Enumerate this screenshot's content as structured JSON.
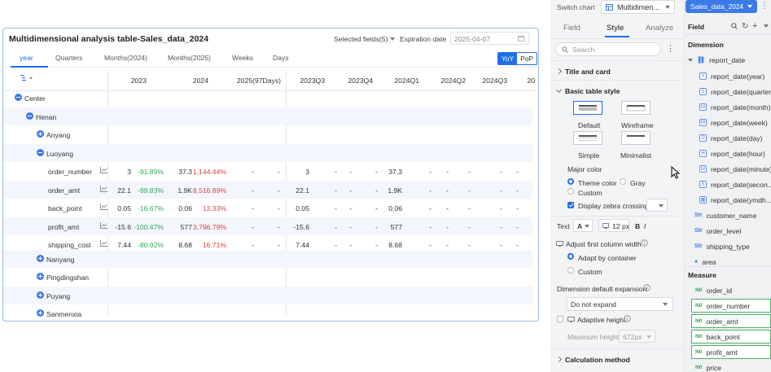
{
  "card": {
    "title": "Multidimensional analysis table-Sales_data_2024",
    "selected_fields": "Selected fields(5)",
    "expiration_label": "Expiration date",
    "expiration_value": "2025-04-07"
  },
  "tabs": [
    "year",
    "Quarters",
    "Months(2024)",
    "Months(2025)",
    "Weeks",
    "Days"
  ],
  "toggle": {
    "yoy": "YoY",
    "pop": "PoP"
  },
  "columns": [
    "2023",
    "2024",
    "2025(97Days)",
    "2023Q3",
    "2023Q4",
    "2024Q1",
    "2024Q2",
    "2024Q3",
    "20"
  ],
  "rows": [
    {
      "label": "Center"
    },
    {
      "label": "Henan"
    },
    {
      "label": "Anyang"
    },
    {
      "label": "Luoyang"
    },
    {
      "label": "order_number",
      "v2023": "3",
      "p2023": "-91.89%",
      "v2024": "37.3",
      "p2024": "1,144.44%",
      "q3": "3",
      "q1": "37.3"
    },
    {
      "label": "order_amt",
      "v2023": "22.1",
      "p2023": "-99.83%",
      "v2024": "1.9K",
      "p2024": "8,516.89%",
      "q3": "22.1",
      "q1": "1.9K"
    },
    {
      "label": "back_point",
      "v2023": "0.05",
      "p2023": "-16.67%",
      "v2024": "0.06",
      "p2024": "13.33%",
      "q3": "0.05",
      "q1": "0.06"
    },
    {
      "label": "profit_amt",
      "v2023": "-15.6",
      "p2023": "-100.47%",
      "v2024": "577",
      "p2024": "3,796.79%",
      "q3": "-15.6",
      "q1": "577"
    },
    {
      "label": "shipping_cost",
      "v2023": "7.44",
      "p2023": "-80.92%",
      "v2024": "8.68",
      "p2024": "16.71%",
      "q3": "7.44",
      "q1": "8.68"
    },
    {
      "label": "Nanyang"
    },
    {
      "label": "Pingdingshan"
    },
    {
      "label": "Puyang"
    },
    {
      "label": "Sanmenxia"
    }
  ],
  "dash": "-",
  "panel": {
    "switch_chart": "Switch chart",
    "chart_type": "Multidimen...",
    "tabs": [
      "Field",
      "Style",
      "Analyze"
    ],
    "search_placeholder": "Search",
    "title_and_card": "Title and card",
    "basic_table_style": "Basic table style",
    "styles": [
      "Default",
      "Wireframe",
      "Simple",
      "Minimalist"
    ],
    "major_color": "Major color",
    "theme_color": "Theme color",
    "gray": "Gray",
    "custom": "Custom",
    "display_zebra": "Display zebra crossing",
    "text_label": "Text",
    "font_size": "12 px",
    "bold": "B",
    "italic": "I",
    "adjust_first_col": "Adjust first column width",
    "adapt_container": "Adapt by container",
    "custom2": "Custom",
    "dim_default_expansion": "Dimension default expansion",
    "expansion_value": "Do not expand",
    "adaptive_height": "Adaptive height",
    "max_height_label": "Maximum height",
    "max_height_value": "672px",
    "calc_method": "Calculation method"
  },
  "fields": {
    "dataset": "Sales_data_2024",
    "field_label": "Field",
    "dimension_label": "Dimension",
    "report_date": "report_date",
    "date_children": [
      "report_date(year)",
      "report_date(quarter)",
      "report_date(month)",
      "report_date(week)",
      "report_date(day)",
      "report_date(hour)",
      "report_date(minute)",
      "report_date(secon...",
      "report_date(ymdh..."
    ],
    "date_icons": [
      "Y",
      "S",
      "M",
      "W",
      "D",
      "H",
      "M",
      "S",
      "▦"
    ],
    "dimensions": [
      "customer_name",
      "order_level",
      "shipping_type",
      "area"
    ],
    "measure_label": "Measure",
    "measures": [
      "order_id",
      "order_number",
      "order_amt",
      "back_point",
      "profit_amt",
      "price"
    ],
    "measure_tag": "N0"
  }
}
